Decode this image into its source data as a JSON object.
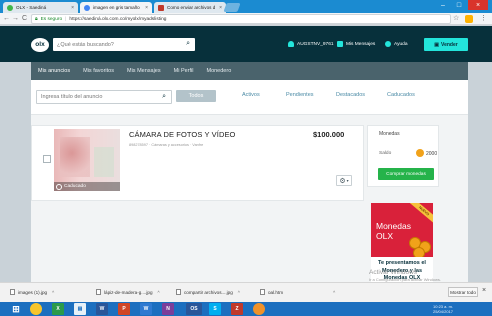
{
  "browser": {
    "tabs": [
      {
        "label": "OLX - Saediná",
        "favicon_color": "#3fb64a",
        "active": false
      },
      {
        "label": "imagen en gris tamaño",
        "favicon_color": "#4285f4",
        "active": true
      },
      {
        "label": "Como enviar archivos d",
        "favicon_color": "#c0392b",
        "active": false
      }
    ],
    "secure_label": "Es seguro",
    "url": "https://saediná.olx.com.co/myolx/myadslisting",
    "back": "←",
    "forward": "→",
    "reload": "C",
    "star": "☆",
    "menu": "⋮"
  },
  "header": {
    "logo": "olx",
    "search_placeholder": "¿Qué estás buscando?",
    "user": "AUGSTNV_9761",
    "messages": "Mis Mensajes",
    "help": "Ayuda",
    "sell": "Vender"
  },
  "subnav": {
    "items": [
      "Mis anuncios",
      "Mis favoritos",
      "Mis Mensajes",
      "Mi Perfil",
      "Monedero"
    ]
  },
  "filters": {
    "search_placeholder": "Ingresa título del anuncio",
    "tabs": [
      "Todos",
      "Activos",
      "Pendientes",
      "Destacados",
      "Caducados"
    ]
  },
  "ad": {
    "title": "CÁMARA DE FOTOS Y VÍDEO",
    "meta": "898278597 · Cámaras y accesorios · Vanfre",
    "price": "$100.000",
    "status": "Caducado"
  },
  "coins": {
    "title": "Monedas",
    "balance_label": "Saldo",
    "balance": "2000",
    "buy": "Comprar monedas"
  },
  "promo": {
    "ribbon": "NUEVO",
    "title_line1": "Monedas",
    "title_line2": "OLX",
    "desc_line1": "Te presentamos el",
    "desc_line2": "Monedero y las",
    "desc_line3": "Monedas OLX"
  },
  "watermark": {
    "line1": "Activar Windows",
    "line2": "Ir a Configuración para activar Windows."
  },
  "downloads": {
    "items": [
      "images (1).jpg",
      "lápiz-de-madera-g....jpg",
      "compartir archivos....jpg",
      "oal.htm"
    ],
    "show_all": "Mostrar todo",
    "close": "×"
  },
  "taskbar": {
    "apps": [
      "W",
      "X",
      "P",
      "N",
      "OS",
      "S",
      "Z"
    ],
    "time": "10:23 a. m.",
    "date": "25/04/2017"
  },
  "colors": {
    "olx_dark": "#07303b",
    "accent_cyan": "#23e5db",
    "green_button": "#25b34a",
    "promo_red": "#d9213a",
    "coin_orange": "#f1a21a"
  }
}
